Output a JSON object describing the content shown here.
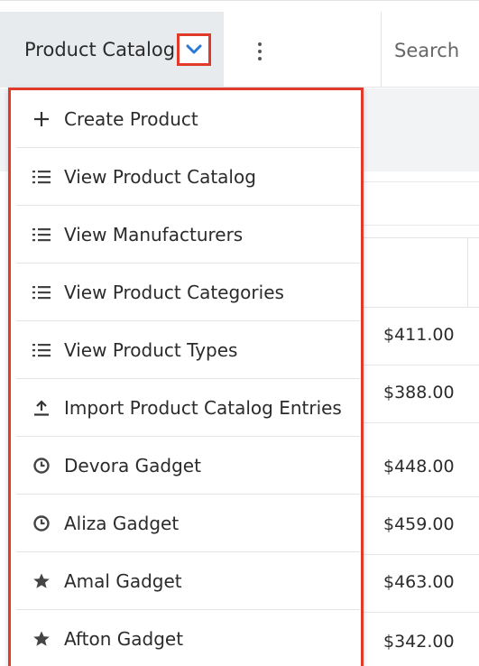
{
  "header": {
    "module_name": "Product Catalog",
    "caret_icon": "chevron-down-icon",
    "more_icon": "vertical-dots-icon",
    "search_placeholder": "Search"
  },
  "list": {
    "prices": [
      "$411.00",
      "$388.00",
      "$448.00",
      "$459.00",
      "$463.00",
      "$342.00"
    ]
  },
  "menu": {
    "items": [
      {
        "label": "Create Product",
        "icon": "plus-icon"
      },
      {
        "label": "View Product Catalog",
        "icon": "list-icon"
      },
      {
        "label": "View Manufacturers",
        "icon": "list-icon"
      },
      {
        "label": "View Product Categories",
        "icon": "list-icon"
      },
      {
        "label": "View Product Types",
        "icon": "list-icon"
      },
      {
        "label": "Import Product Catalog Entries",
        "icon": "upload-icon"
      },
      {
        "label": "Devora Gadget",
        "icon": "clock-icon"
      },
      {
        "label": "Aliza Gadget",
        "icon": "clock-icon"
      },
      {
        "label": "Amal Gadget",
        "icon": "star-icon"
      },
      {
        "label": "Afton Gadget",
        "icon": "star-icon"
      }
    ]
  },
  "colors": {
    "highlight": "#e13a2b",
    "caret": "#2a7ad5",
    "tab_bg": "#e8ebee"
  }
}
